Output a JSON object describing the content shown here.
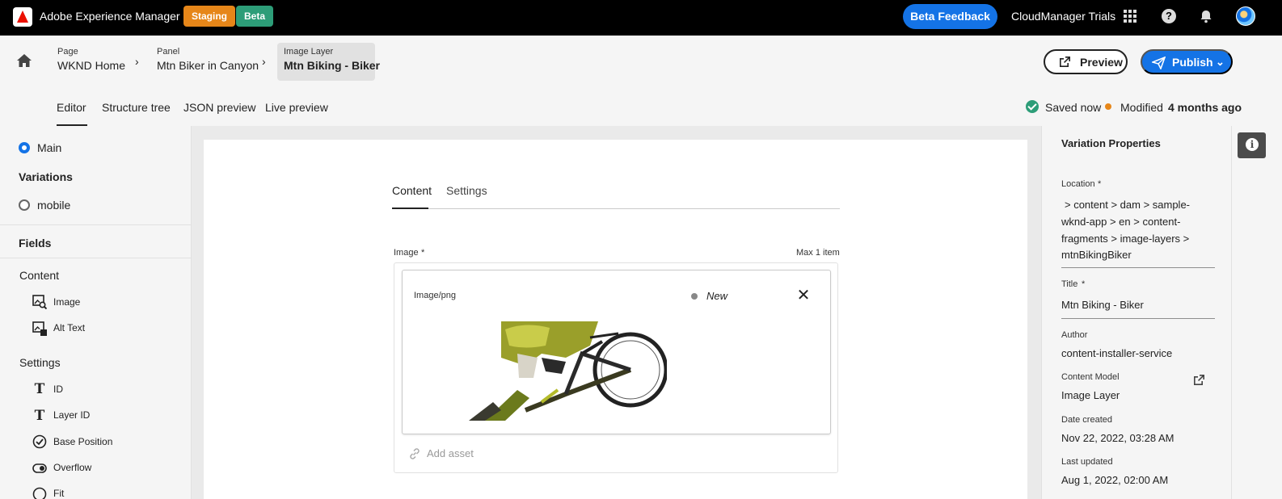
{
  "topbar": {
    "app_title": "Adobe Experience Manager",
    "badge_staging": "Staging",
    "badge_beta": "Beta",
    "beta_feedback": "Beta Feedback",
    "org_name": "CloudManager Trials",
    "apps_icon": "apps-grid-icon",
    "help_icon": "help-icon",
    "bell_icon": "bell-icon"
  },
  "breadcrumb": [
    {
      "sub": "Page",
      "main": "WKND Home"
    },
    {
      "sub": "Panel",
      "main": "Mtn Biker in Canyon"
    },
    {
      "sub": "Image Layer",
      "main": "Mtn Biking - Biker"
    }
  ],
  "actions": {
    "preview_label": "Preview",
    "publish_label": "Publish"
  },
  "tabs": [
    "Editor",
    "Structure tree",
    "JSON preview",
    "Live preview"
  ],
  "status": {
    "saved": "Saved now",
    "modified_label": "Modified",
    "modified_time": "4 months ago"
  },
  "left_panel": {
    "main_label": "Main",
    "variations_heading": "Variations",
    "variation_mobile": "mobile",
    "fields_heading": "Fields",
    "content_group": "Content",
    "content_fields": [
      "Image",
      "Alt Text"
    ],
    "settings_group": "Settings",
    "settings_fields": [
      "ID",
      "Layer ID",
      "Base Position",
      "Overflow",
      "Fit"
    ]
  },
  "editor": {
    "tab_content": "Content",
    "tab_settings": "Settings",
    "image_label": "Image",
    "required_mark": "*",
    "max_items": "Max 1 item",
    "mime_type": "Image/png",
    "asset_status": "New",
    "add_asset": "Add asset"
  },
  "right_panel": {
    "title": "Variation Properties",
    "location_label": "Location",
    "location_lines": [
      "> content > dam > sample-",
      "wknd-app > en > content-",
      "fragments > image-layers >",
      "mtnBikingBiker"
    ],
    "title_label": "Title",
    "title_value": "Mtn Biking - Biker",
    "author_label": "Author",
    "author_value": "content-installer-service",
    "model_label": "Content Model",
    "model_value": "Image Layer",
    "created_label": "Date created",
    "created_value": "Nov 22, 2022, 03:28 AM",
    "updated_label": "Last updated",
    "updated_value": "Aug 1, 2022, 02:00 AM"
  },
  "colors": {
    "accent": "#1473e6",
    "staging": "#e68619",
    "beta": "#2d9d78",
    "saved": "#2d9d78"
  }
}
